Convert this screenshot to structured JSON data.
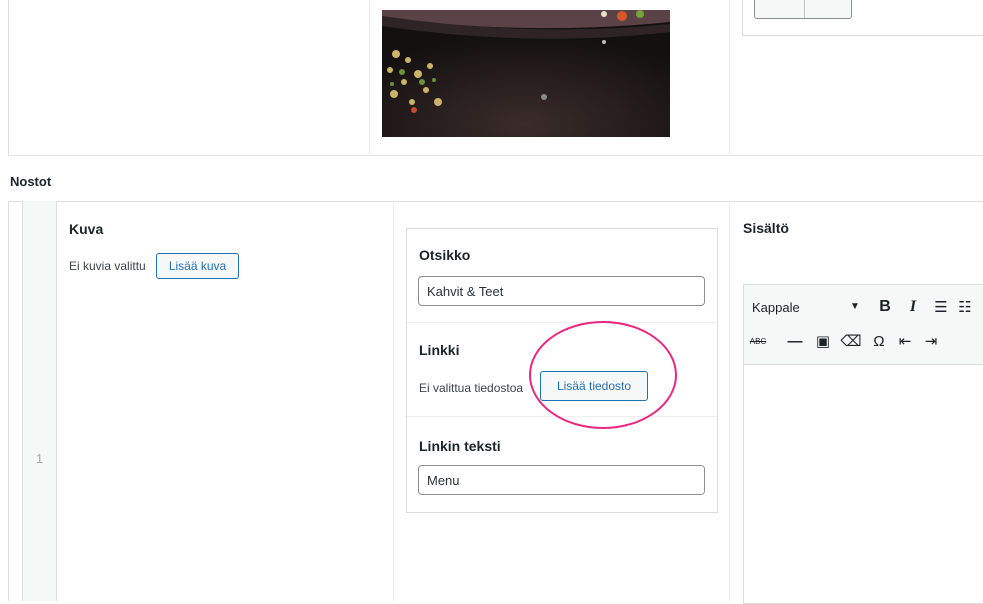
{
  "section_label": "Nostot",
  "row": {
    "number": "1",
    "image_field": {
      "label": "Kuva",
      "empty_text": "Ei kuvia valittu",
      "add_button": "Lisää kuva"
    },
    "group": {
      "title_field": {
        "label": "Otsikko",
        "value": "Kahvit & Teet"
      },
      "link_field": {
        "label": "Linkki",
        "empty_text": "Ei valittua tiedostoa",
        "add_button": "Lisää tiedosto"
      },
      "link_text_field": {
        "label": "Linkin teksti",
        "value": "Menu"
      }
    },
    "content_field": {
      "label": "Sisältö",
      "format_select": "Kappale",
      "toolbar_row1": [
        "B",
        "I",
        "☰",
        "☷"
      ],
      "toolbar_row2": [
        "ABC",
        "—",
        "▣",
        "⌫",
        "Ω",
        "⇤",
        "⇥"
      ]
    }
  },
  "colors": {
    "accent": "#2271b1",
    "highlight_ring": "#e8287f",
    "border": "#dcdcde"
  }
}
